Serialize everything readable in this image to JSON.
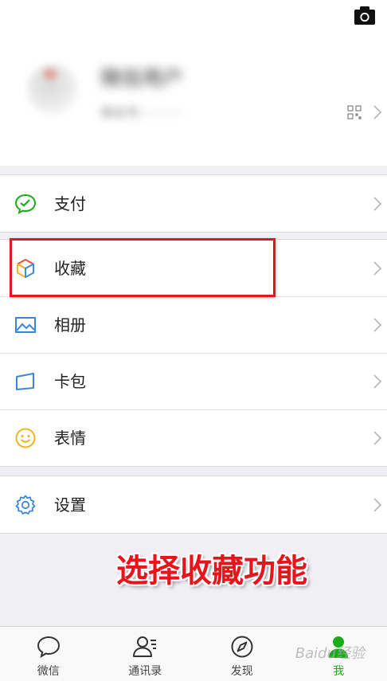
{
  "profile": {
    "nickname": "微信用户",
    "account": "微信号：·········"
  },
  "menu": {
    "groups": [
      [
        {
          "label": "支付",
          "icon": "wallet-icon"
        }
      ],
      [
        {
          "label": "收藏",
          "icon": "favorites-cube-icon"
        },
        {
          "label": "相册",
          "icon": "album-icon"
        },
        {
          "label": "卡包",
          "icon": "card-icon"
        },
        {
          "label": "表情",
          "icon": "sticker-smile-icon"
        }
      ],
      [
        {
          "label": "设置",
          "icon": "settings-gear-icon"
        }
      ]
    ]
  },
  "caption": "选择收藏功能",
  "tabbar": {
    "tabs": [
      {
        "label": "微信",
        "icon": "chat-bubble-icon"
      },
      {
        "label": "通讯录",
        "icon": "contacts-icon"
      },
      {
        "label": "发现",
        "icon": "compass-icon"
      },
      {
        "label": "我",
        "icon": "me-person-icon",
        "active": true
      }
    ]
  },
  "watermark": "Baidu经验",
  "colors": {
    "accent_green": "#1aad19",
    "highlight_red": "#e0171d",
    "caption_red": "#e8141c"
  }
}
